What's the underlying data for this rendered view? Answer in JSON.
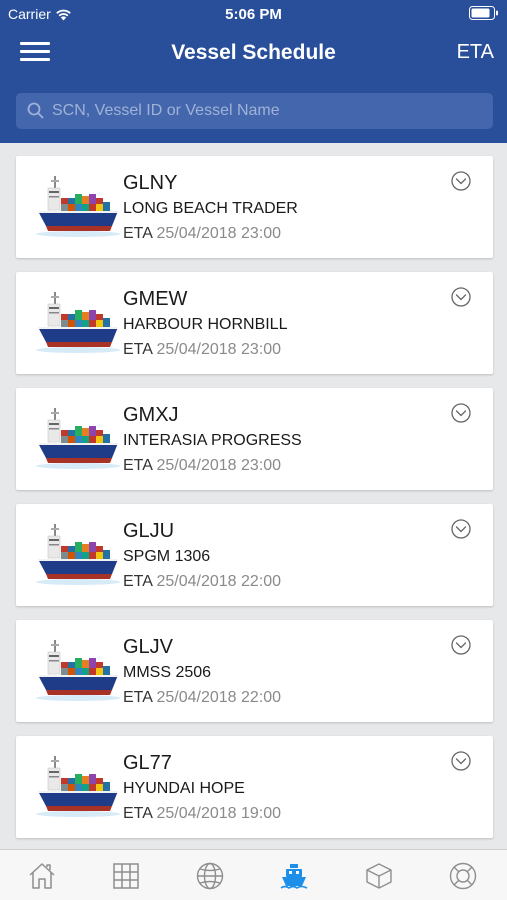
{
  "status": {
    "carrier": "Carrier",
    "time": "5:06 PM"
  },
  "header": {
    "title": "Vessel Schedule",
    "eta_label": "ETA"
  },
  "search": {
    "placeholder": "SCN, Vessel ID or Vessel Name",
    "value": ""
  },
  "vessels": [
    {
      "code": "GLNY",
      "name": "LONG BEACH TRADER",
      "eta_label": "ETA",
      "eta": "25/04/2018 23:00"
    },
    {
      "code": "GMEW",
      "name": "HARBOUR HORNBILL",
      "eta_label": "ETA",
      "eta": "25/04/2018 23:00"
    },
    {
      "code": "GMXJ",
      "name": "INTERASIA PROGRESS",
      "eta_label": "ETA",
      "eta": "25/04/2018 23:00"
    },
    {
      "code": "GLJU",
      "name": "SPGM 1306",
      "eta_label": "ETA",
      "eta": "25/04/2018 22:00"
    },
    {
      "code": "GLJV",
      "name": "MMSS 2506",
      "eta_label": "ETA",
      "eta": "25/04/2018 22:00"
    },
    {
      "code": "GL77",
      "name": "HYUNDAI HOPE",
      "eta_label": "ETA",
      "eta": "25/04/2018 19:00"
    }
  ],
  "tabs": [
    {
      "icon": "home-icon",
      "active": false
    },
    {
      "icon": "grid-icon",
      "active": false
    },
    {
      "icon": "globe-icon",
      "active": false
    },
    {
      "icon": "ship-icon",
      "active": true
    },
    {
      "icon": "box-icon",
      "active": false
    },
    {
      "icon": "lifebuoy-icon",
      "active": false
    }
  ],
  "colors": {
    "primary": "#2a4f9a",
    "search_bg": "#4366ad",
    "active_tab": "#1e8fe8",
    "inactive_tab": "#8e8e8e"
  }
}
